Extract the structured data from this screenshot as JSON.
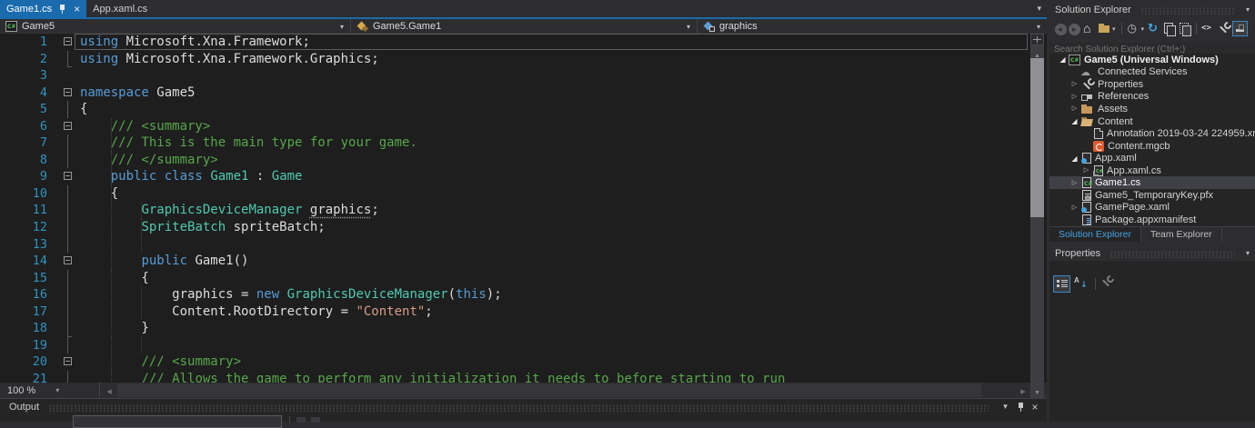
{
  "colors": {
    "accent": "#1A6BAD",
    "chrome_bg": "#2D2D30",
    "editor_bg": "#1E1E1E",
    "panel_bg": "#252526",
    "selection": "#3F3F46"
  },
  "tab_bar": {
    "tabs": [
      {
        "label": "Game1.cs",
        "active": true,
        "pinned": true
      },
      {
        "label": "App.xaml.cs",
        "active": false
      }
    ]
  },
  "navigation_bar": {
    "project": "Game5",
    "type": "Game5.Game1",
    "member": "graphics",
    "icons": [
      "csharp-project-icon",
      "class-icon",
      "field-icon"
    ]
  },
  "editor": {
    "zoom_level": "100 %",
    "syntax_colors": {
      "keyword": "#569CD6",
      "type": "#4EC9B0",
      "string": "#D69D85",
      "comment": "#57A64A",
      "plain": "#DCDCDC",
      "line_number": "#2E93BE"
    },
    "lines": [
      {
        "num": 1,
        "fold": "box",
        "current": true,
        "guides": [],
        "segments": [
          {
            "text": "using",
            "style": "keyword"
          },
          {
            "text": " Microsoft.Xna.Framework;",
            "style": "plain"
          }
        ]
      },
      {
        "num": 2,
        "fold": "end",
        "guides": [],
        "segments": [
          {
            "text": "using",
            "style": "keyword"
          },
          {
            "text": " Microsoft.Xna.Framework.Graphics;",
            "style": "plain"
          }
        ]
      },
      {
        "num": 3,
        "fold": "",
        "guides": [],
        "segments": []
      },
      {
        "num": 4,
        "fold": "box",
        "guides": [],
        "segments": [
          {
            "text": "namespace",
            "style": "keyword"
          },
          {
            "text": " Game5",
            "style": "plain"
          }
        ]
      },
      {
        "num": 5,
        "fold": "line",
        "guides": [],
        "segments": [
          {
            "text": "{",
            "style": "plain"
          }
        ]
      },
      {
        "num": 6,
        "fold": "box",
        "guides": [
          4
        ],
        "segments": [
          {
            "text": "    ",
            "style": "plain"
          },
          {
            "text": "/// <summary>",
            "style": "comment"
          }
        ]
      },
      {
        "num": 7,
        "fold": "line",
        "guides": [
          4
        ],
        "segments": [
          {
            "text": "    ",
            "style": "plain"
          },
          {
            "text": "/// This is the main type for your game.",
            "style": "comment"
          }
        ]
      },
      {
        "num": 8,
        "fold": "line",
        "guides": [
          4
        ],
        "segments": [
          {
            "text": "    ",
            "style": "plain"
          },
          {
            "text": "/// </summary>",
            "style": "comment"
          }
        ]
      },
      {
        "num": 9,
        "fold": "box",
        "guides": [
          4
        ],
        "segments": [
          {
            "text": "    ",
            "style": "plain"
          },
          {
            "text": "public class",
            "style": "keyword"
          },
          {
            "text": " ",
            "style": "plain"
          },
          {
            "text": "Game1",
            "style": "type"
          },
          {
            "text": " : ",
            "style": "plain"
          },
          {
            "text": "Game",
            "style": "type"
          }
        ]
      },
      {
        "num": 10,
        "fold": "line",
        "guides": [
          4
        ],
        "segments": [
          {
            "text": "    {",
            "style": "plain"
          }
        ]
      },
      {
        "num": 11,
        "fold": "line",
        "guides": [
          4,
          8
        ],
        "segments": [
          {
            "text": "        ",
            "style": "plain"
          },
          {
            "text": "GraphicsDeviceManager",
            "style": "type"
          },
          {
            "text": " ",
            "style": "plain"
          },
          {
            "text": "graphics",
            "style": "plain",
            "underline": true
          },
          {
            "text": ";",
            "style": "plain"
          }
        ]
      },
      {
        "num": 12,
        "fold": "line",
        "guides": [
          4,
          8
        ],
        "segments": [
          {
            "text": "        ",
            "style": "plain"
          },
          {
            "text": "SpriteBatch",
            "style": "type"
          },
          {
            "text": " spriteBatch;",
            "style": "plain"
          }
        ]
      },
      {
        "num": 13,
        "fold": "line",
        "guides": [
          4,
          8
        ],
        "segments": []
      },
      {
        "num": 14,
        "fold": "box",
        "guides": [
          4
        ],
        "segments": [
          {
            "text": "        ",
            "style": "plain"
          },
          {
            "text": "public",
            "style": "keyword"
          },
          {
            "text": " Game1()",
            "style": "plain"
          }
        ]
      },
      {
        "num": 15,
        "fold": "line",
        "guides": [
          4
        ],
        "segments": [
          {
            "text": "        {",
            "style": "plain"
          }
        ]
      },
      {
        "num": 16,
        "fold": "line",
        "guides": [
          4,
          8
        ],
        "segments": [
          {
            "text": "            graphics = ",
            "style": "plain"
          },
          {
            "text": "new",
            "style": "keyword"
          },
          {
            "text": " ",
            "style": "plain"
          },
          {
            "text": "GraphicsDeviceManager",
            "style": "type"
          },
          {
            "text": "(",
            "style": "plain"
          },
          {
            "text": "this",
            "style": "keyword"
          },
          {
            "text": ");",
            "style": "plain"
          }
        ]
      },
      {
        "num": 17,
        "fold": "line",
        "guides": [
          4,
          8
        ],
        "segments": [
          {
            "text": "            Content.RootDirectory = ",
            "style": "plain"
          },
          {
            "text": "\"Content\"",
            "style": "string"
          },
          {
            "text": ";",
            "style": "plain"
          }
        ]
      },
      {
        "num": 18,
        "fold": "end",
        "guides": [
          4
        ],
        "segments": [
          {
            "text": "        }",
            "style": "plain"
          }
        ]
      },
      {
        "num": 19,
        "fold": "line",
        "guides": [
          4,
          8
        ],
        "segments": []
      },
      {
        "num": 20,
        "fold": "box",
        "guides": [
          4
        ],
        "segments": [
          {
            "text": "        ",
            "style": "plain"
          },
          {
            "text": "/// <summary>",
            "style": "comment"
          }
        ]
      },
      {
        "num": 21,
        "fold": "line",
        "guides": [
          4
        ],
        "segments": [
          {
            "text": "        ",
            "style": "plain"
          },
          {
            "text": "/// Allows the game to perform any initialization it needs to before starting to run",
            "style": "comment"
          }
        ]
      }
    ]
  },
  "output_panel": {
    "title": "Output",
    "icons": [
      "chevron-down",
      "pin",
      "close"
    ]
  },
  "solution_explorer": {
    "title": "Solution Explorer",
    "search_placeholder": "Search Solution Explorer (Ctrl+;)",
    "toolbar": [
      "back",
      "forward",
      "home",
      "switch-views",
      "separator",
      "pending-changes-filter",
      "refresh",
      "nest-related-files",
      "show-all-files",
      "separator",
      "view-code",
      "properties",
      "preview-selected-items"
    ],
    "tree": [
      {
        "label": "Game5 (Universal Windows)",
        "indent": 0,
        "expander": "open",
        "icon": "csharp-project",
        "bold": true
      },
      {
        "label": "Connected Services",
        "indent": 1,
        "expander": null,
        "icon": "connected-services"
      },
      {
        "label": "Properties",
        "indent": 1,
        "expander": "closed",
        "icon": "wrench"
      },
      {
        "label": "References",
        "indent": 1,
        "expander": "closed",
        "icon": "references"
      },
      {
        "label": "Assets",
        "indent": 1,
        "expander": "closed",
        "icon": "folder"
      },
      {
        "label": "Content",
        "indent": 1,
        "expander": "open",
        "icon": "folder-open"
      },
      {
        "label": "Annotation 2019-03-24 224959.xnb",
        "indent": 2,
        "expander": null,
        "icon": "file"
      },
      {
        "label": "Content.mgcb",
        "indent": 2,
        "expander": null,
        "icon": "mgcb"
      },
      {
        "label": "App.xaml",
        "indent": 1,
        "expander": "open",
        "icon": "xaml"
      },
      {
        "label": "App.xaml.cs",
        "indent": 2,
        "expander": "closed",
        "icon": "csharp-file-dep"
      },
      {
        "label": "Game1.cs",
        "indent": 1,
        "expander": "closed",
        "icon": "csharp-file",
        "selected": true
      },
      {
        "label": "Game5_TemporaryKey.pfx",
        "indent": 1,
        "expander": null,
        "icon": "pfx"
      },
      {
        "label": "GamePage.xaml",
        "indent": 1,
        "expander": "closed",
        "icon": "xaml"
      },
      {
        "label": "Package.appxmanifest",
        "indent": 1,
        "expander": null,
        "icon": "manifest"
      }
    ],
    "bottom_tabs": [
      {
        "label": "Solution Explorer",
        "active": true
      },
      {
        "label": "Team Explorer",
        "active": false
      }
    ]
  },
  "properties_panel": {
    "title": "Properties",
    "toolbar": [
      "categorized",
      "alphabetical",
      "separator",
      "property-pages"
    ]
  }
}
